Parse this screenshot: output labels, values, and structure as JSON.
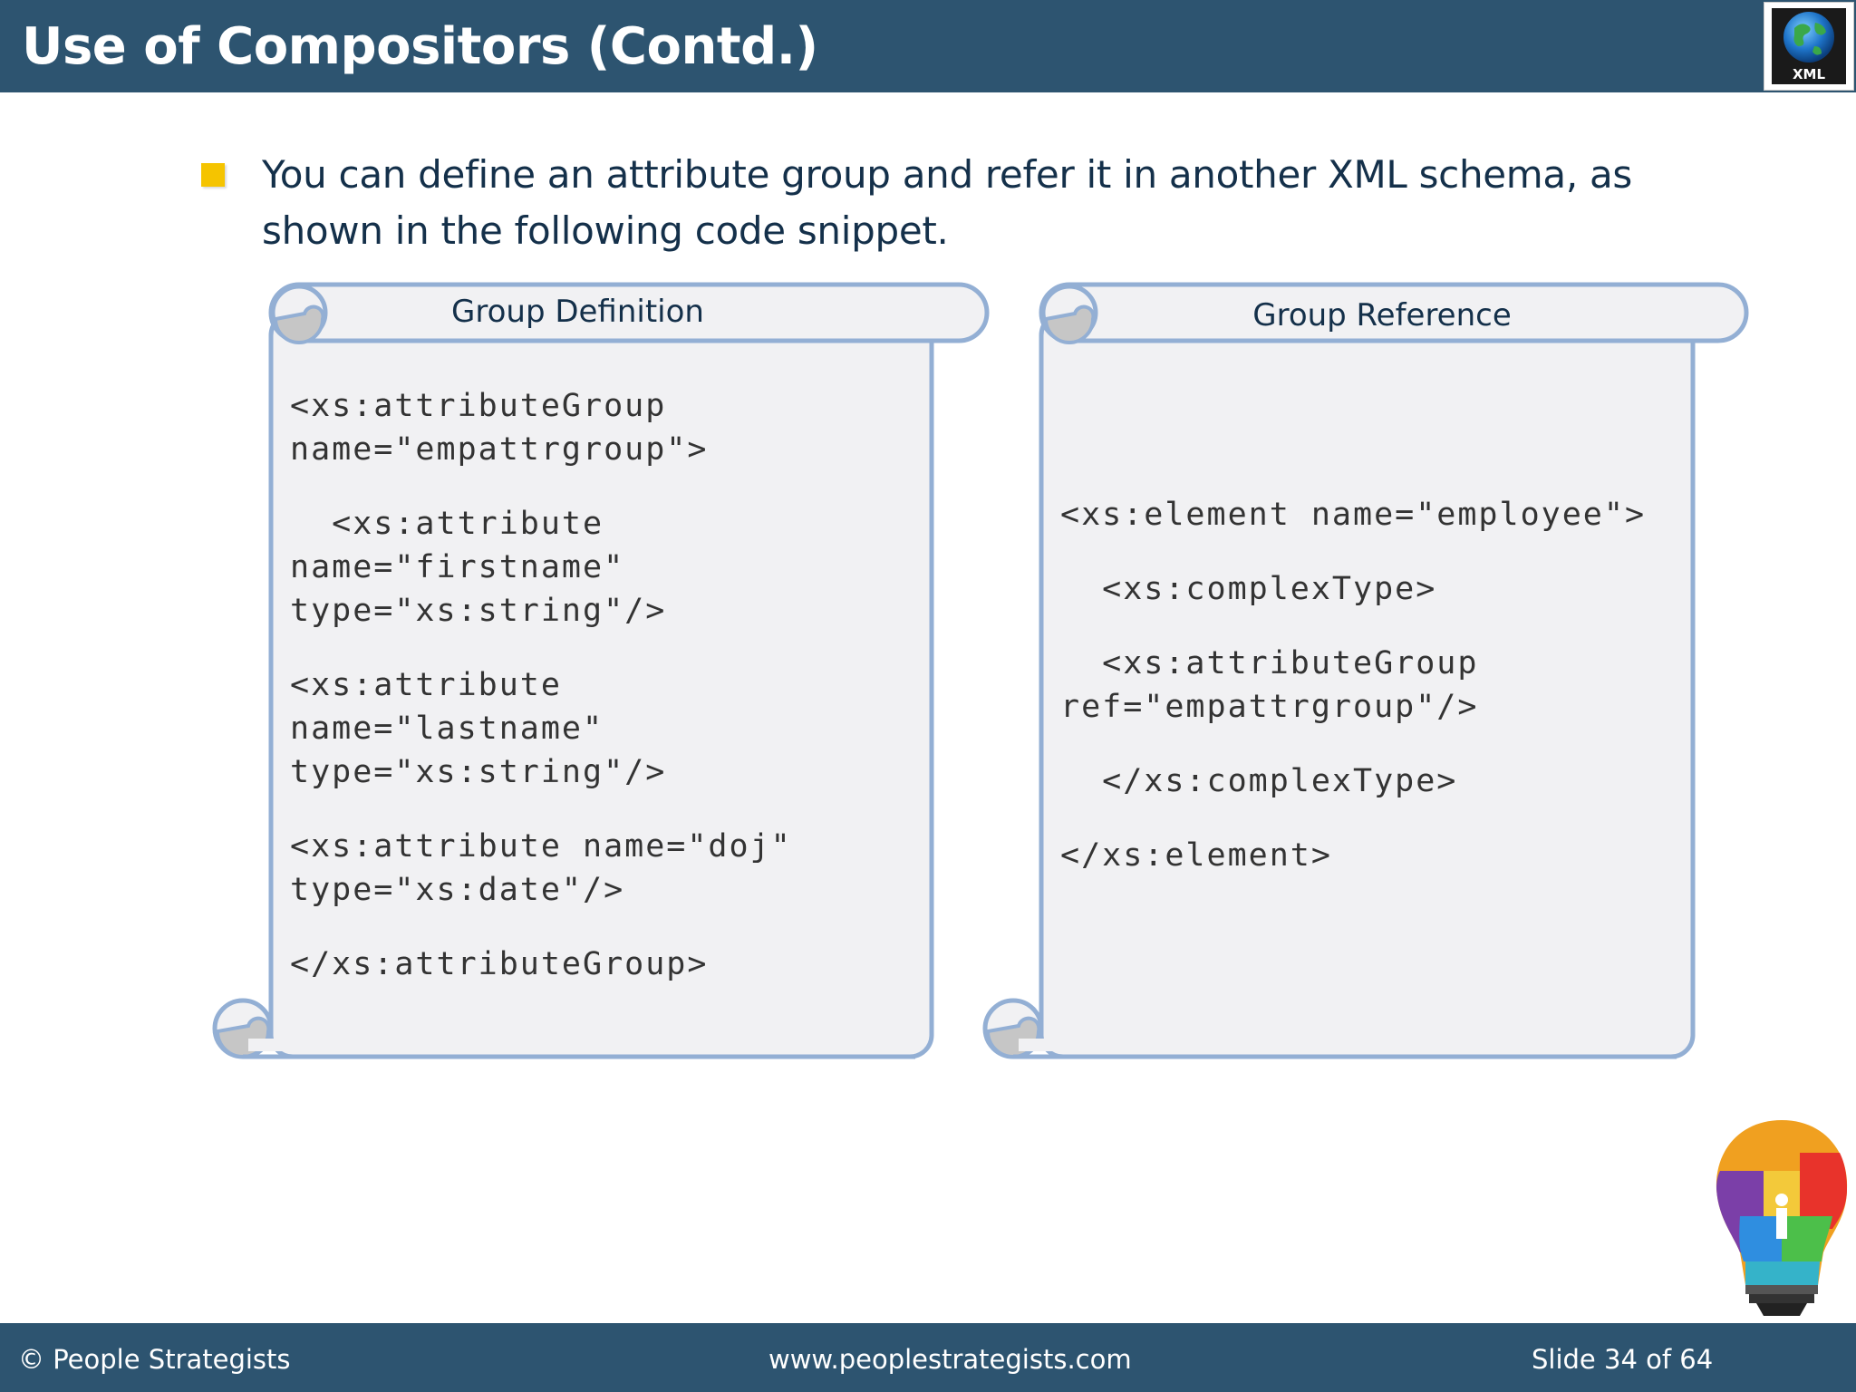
{
  "slide": {
    "title": "Use of Compositors (Contd.)",
    "logo_text": "XML",
    "bullet": "You can define an attribute group and refer it in another XML schema, as shown in the following code snippet."
  },
  "definition": {
    "title": "Group Definition",
    "code_lines": [
      "<xs:attributeGroup",
      "name=\"empattrgroup\">",
      "",
      "  <xs:attribute",
      "name=\"firstname\"",
      "type=\"xs:string\"/>",
      "",
      "<xs:attribute",
      "name=\"lastname\"",
      "type=\"xs:string\"/>",
      "",
      "<xs:attribute name=\"doj\"",
      "type=\"xs:date\"/>",
      "",
      "</xs:attributeGroup>"
    ]
  },
  "reference": {
    "title": "Group Reference",
    "code_lines": [
      "<xs:element name=\"employee\">",
      "",
      "  <xs:complexType>",
      "",
      "  <xs:attributeGroup",
      "ref=\"empattrgroup\"/>",
      "",
      "  </xs:complexType>",
      "",
      "</xs:element>"
    ]
  },
  "footer": {
    "copyright": "© People Strategists",
    "website": "www.peoplestrategists.com",
    "slide_number": "Slide 34 of 64"
  },
  "colors": {
    "header_bg": "#2d5470",
    "bullet": "#f5c400",
    "scroll_fill": "#f1f1f3",
    "scroll_border": "#93afd4",
    "curl_fill": "#c6c6c6"
  }
}
